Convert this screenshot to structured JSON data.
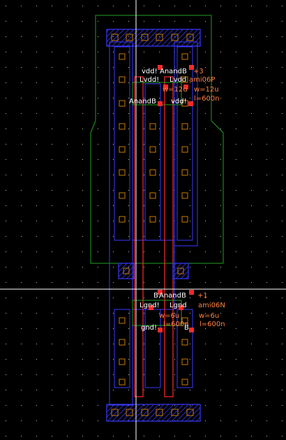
{
  "view": {
    "background": "#000000",
    "grid_color": "#bfbfbf",
    "crosshair_color": "#ffffff",
    "colors": {
      "nwell": "#22a022",
      "metal1": "#3a3aff",
      "metal1_fill": "#1a1a9c",
      "poly": "#ff2a2a",
      "active": "#3a3aff",
      "contact": "#c87a00",
      "pin": "#ff2a2a",
      "select": "#ffffff",
      "text_white": "#ffffff",
      "text_orange": "#ff8040",
      "text_green": "#7fff7f"
    },
    "icons": {
      "crosshair": "crosshair-icon",
      "pin": "pin-marker-icon"
    }
  },
  "labels": {
    "p_top_net": "vdd!",
    "p_top_inst": "AnandB",
    "p_sub_a": "Lvdd!",
    "p_sub_b": "Lvdd",
    "p_dev_idx": "+3",
    "p_model": "ami06P",
    "p_w_left": "w=12u",
    "p_w_right": "w=12u",
    "p_l": "l=600n",
    "p_net_left": "AnandB",
    "p_net_right": "vdd!",
    "n_top_net": "B",
    "n_top_inst": "AnandB",
    "n_dev_idx": "+1",
    "n_sub_a": "Lgnd!",
    "n_sub_b": "Lgnd",
    "n_model": "ami06N",
    "n_w_left": "w=6u",
    "n_w_right": "w=6u",
    "n_net_left": "gnd!",
    "n_l_left": "l=600n",
    "n_l_right": "l=600n",
    "n_net_mid": "B"
  }
}
